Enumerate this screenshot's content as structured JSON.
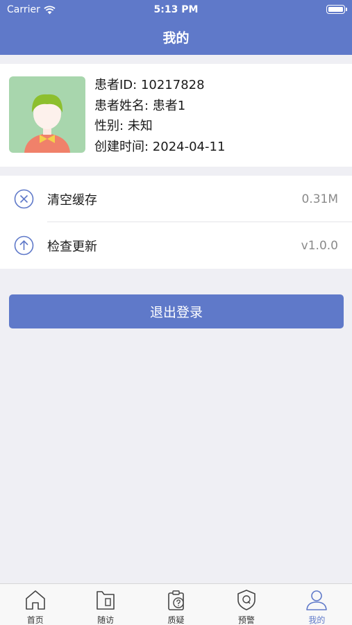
{
  "status_bar": {
    "carrier": "Carrier",
    "time": "5:13 PM"
  },
  "header": {
    "title": "我的"
  },
  "profile": {
    "id_line": "患者ID: 10217828",
    "name_line": "患者姓名: 患者1",
    "gender_line": "性别: 未知",
    "created_line": "创建时间: 2024-04-11"
  },
  "settings": [
    {
      "label": "清空缓存",
      "value": "0.31M",
      "icon": "clear-cache-icon"
    },
    {
      "label": "检查更新",
      "value": "v1.0.0",
      "icon": "check-update-icon"
    }
  ],
  "logout_label": "退出登录",
  "tabs": [
    {
      "label": "首页",
      "icon": "home-icon"
    },
    {
      "label": "随访",
      "icon": "follow-up-icon"
    },
    {
      "label": "质疑",
      "icon": "query-icon"
    },
    {
      "label": "预警",
      "icon": "alert-shield-icon"
    },
    {
      "label": "我的",
      "icon": "profile-icon",
      "active": true
    }
  ],
  "colors": {
    "primary": "#5f79c9",
    "background": "#efeff4"
  }
}
